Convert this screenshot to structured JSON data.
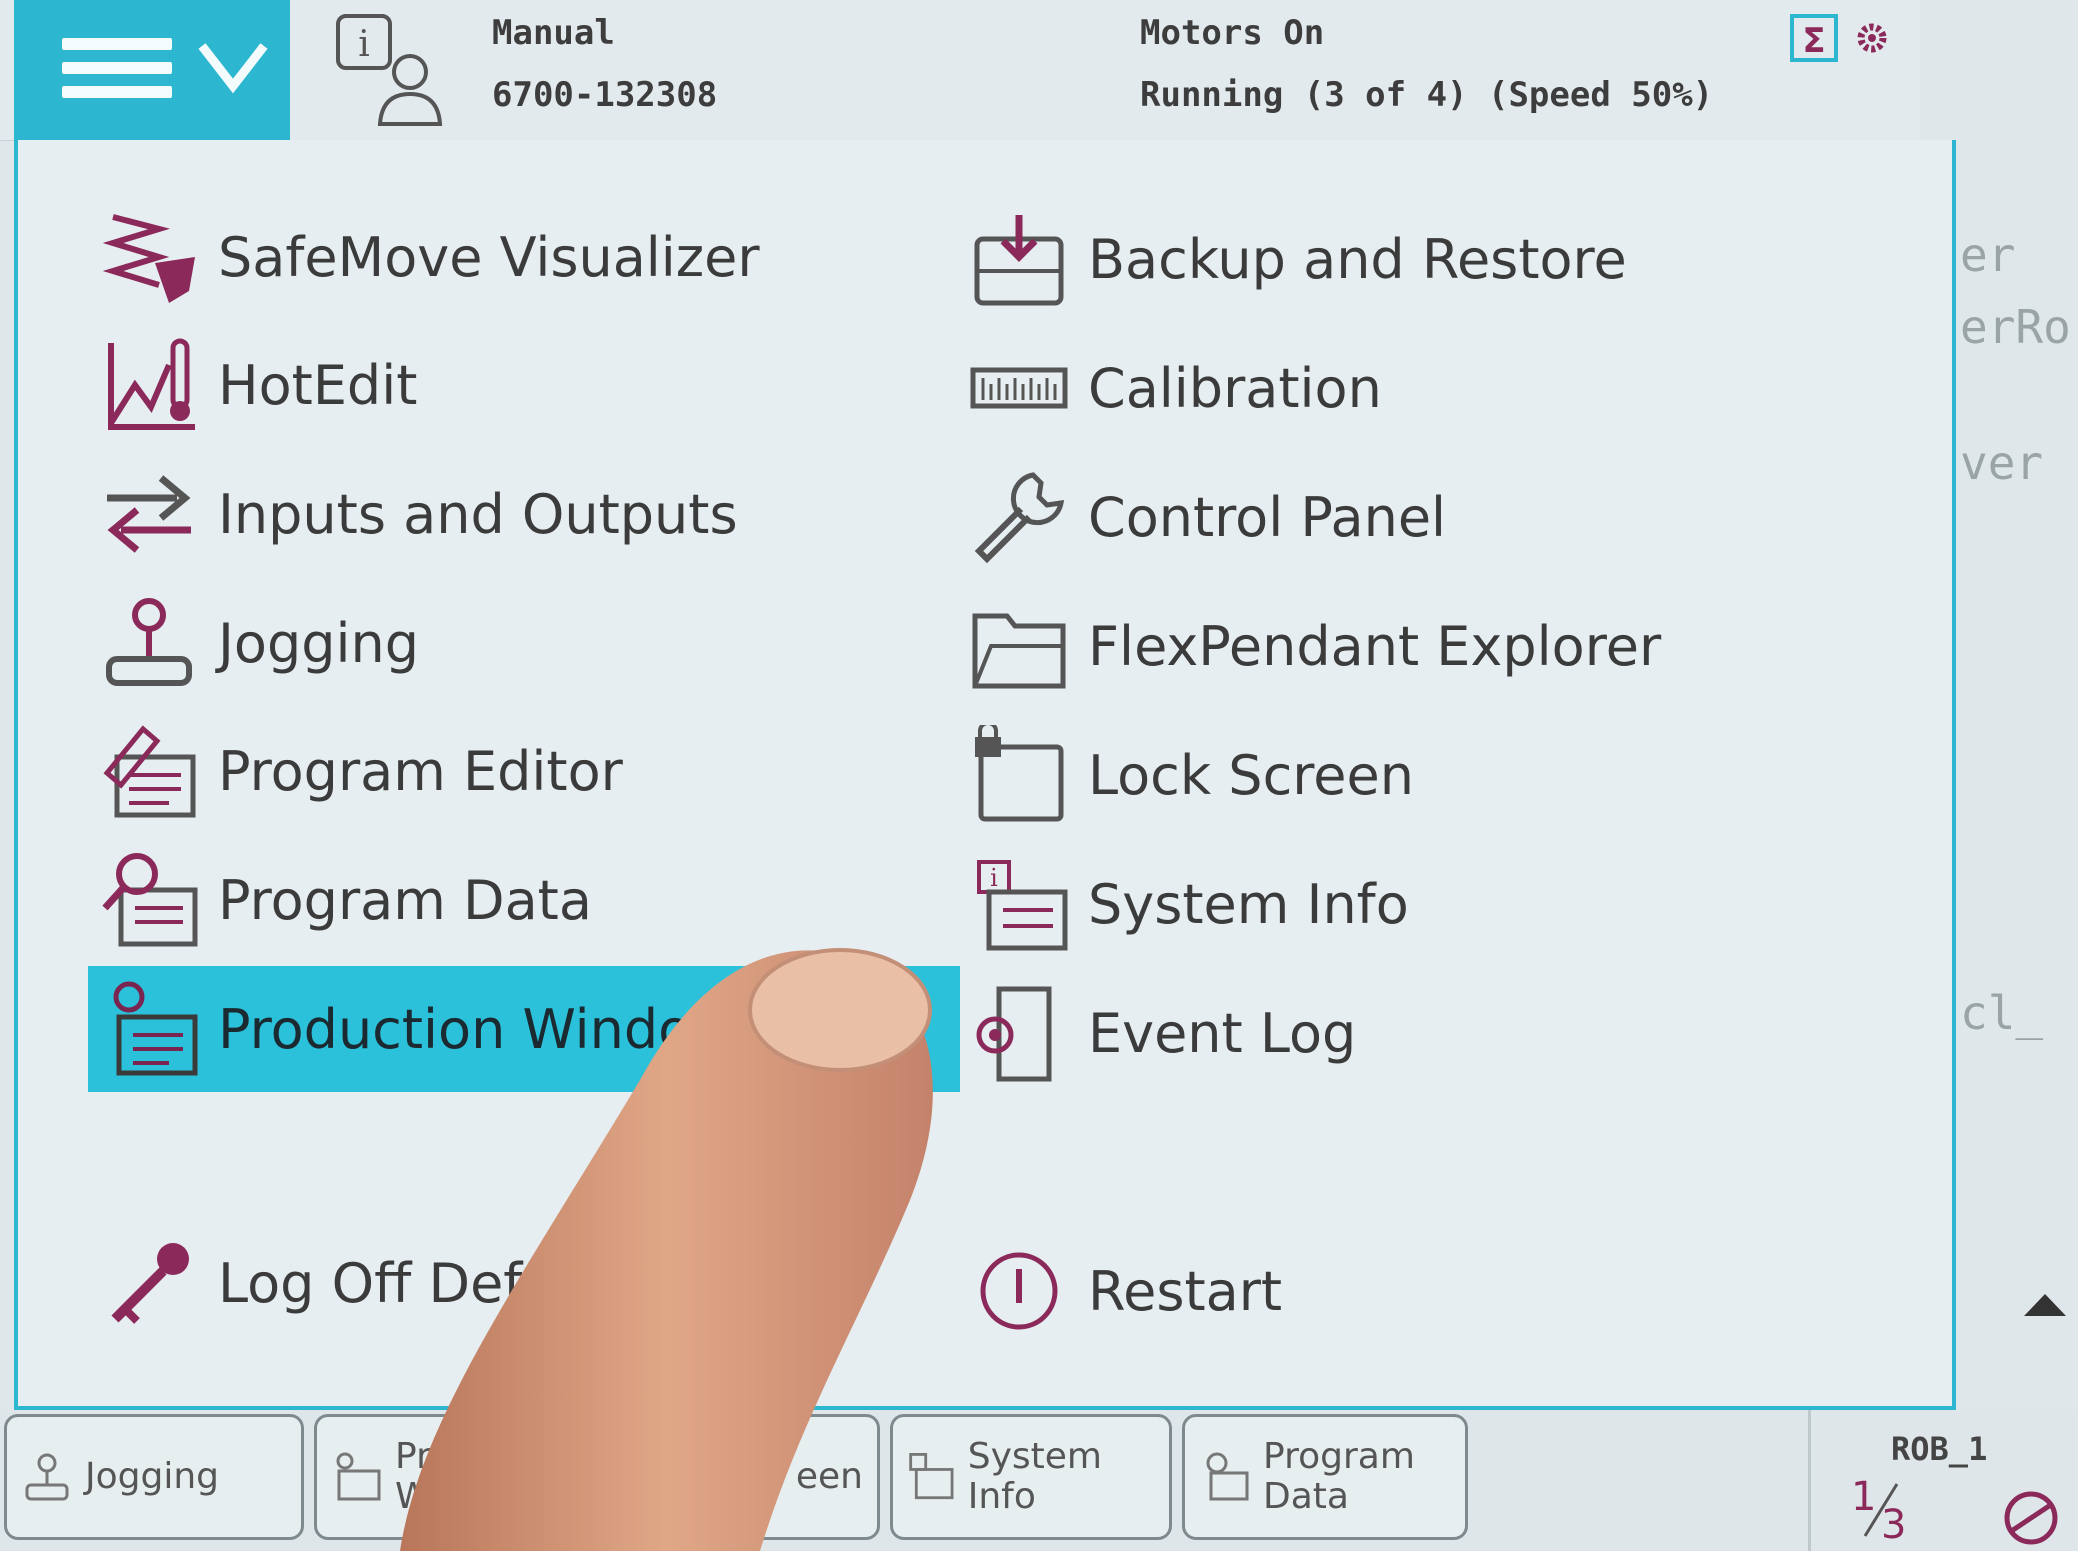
{
  "header": {
    "mode": "Manual",
    "system": "6700-132308",
    "motors": "Motors On",
    "run_state": "Running (3 of 4) (Speed 50%)"
  },
  "menu": {
    "left": [
      {
        "label": "SafeMove Visualizer",
        "icon": "safemove-icon"
      },
      {
        "label": "HotEdit",
        "icon": "hotedit-icon"
      },
      {
        "label": "Inputs and Outputs",
        "icon": "inputs-outputs-icon"
      },
      {
        "label": "Jogging",
        "icon": "jogging-icon"
      },
      {
        "label": "Program Editor",
        "icon": "program-editor-icon"
      },
      {
        "label": "Program Data",
        "icon": "program-data-icon"
      },
      {
        "label": "Production Windo",
        "icon": "production-window-icon",
        "selected": true
      }
    ],
    "right": [
      {
        "label": "Backup and Restore",
        "icon": "backup-icon"
      },
      {
        "label": "Calibration",
        "icon": "calibration-icon"
      },
      {
        "label": "Control Panel",
        "icon": "wrench-icon"
      },
      {
        "label": "FlexPendant Explorer",
        "icon": "folder-icon"
      },
      {
        "label": "Lock Screen",
        "icon": "lock-icon"
      },
      {
        "label": "System Info",
        "icon": "system-info-icon"
      },
      {
        "label": "Event Log",
        "icon": "event-log-icon"
      }
    ],
    "log_off": "Log Off Def",
    "restart": "Restart"
  },
  "background_code": {
    "line1": "er",
    "line2": "erRo",
    "line3": "ver",
    "line4": "cl_"
  },
  "taskbar": {
    "items": [
      {
        "label": "Jogging"
      },
      {
        "label": "Pro\nW"
      },
      {
        "label": "een"
      },
      {
        "label": "System Info"
      },
      {
        "label": "Program\nData"
      }
    ],
    "rob": "ROB_1",
    "fraction_num": "1",
    "fraction_den": "3"
  },
  "colors": {
    "accent": "#2cb6cf",
    "icon": "#8b2a5a",
    "selected": "#2cc1da"
  }
}
